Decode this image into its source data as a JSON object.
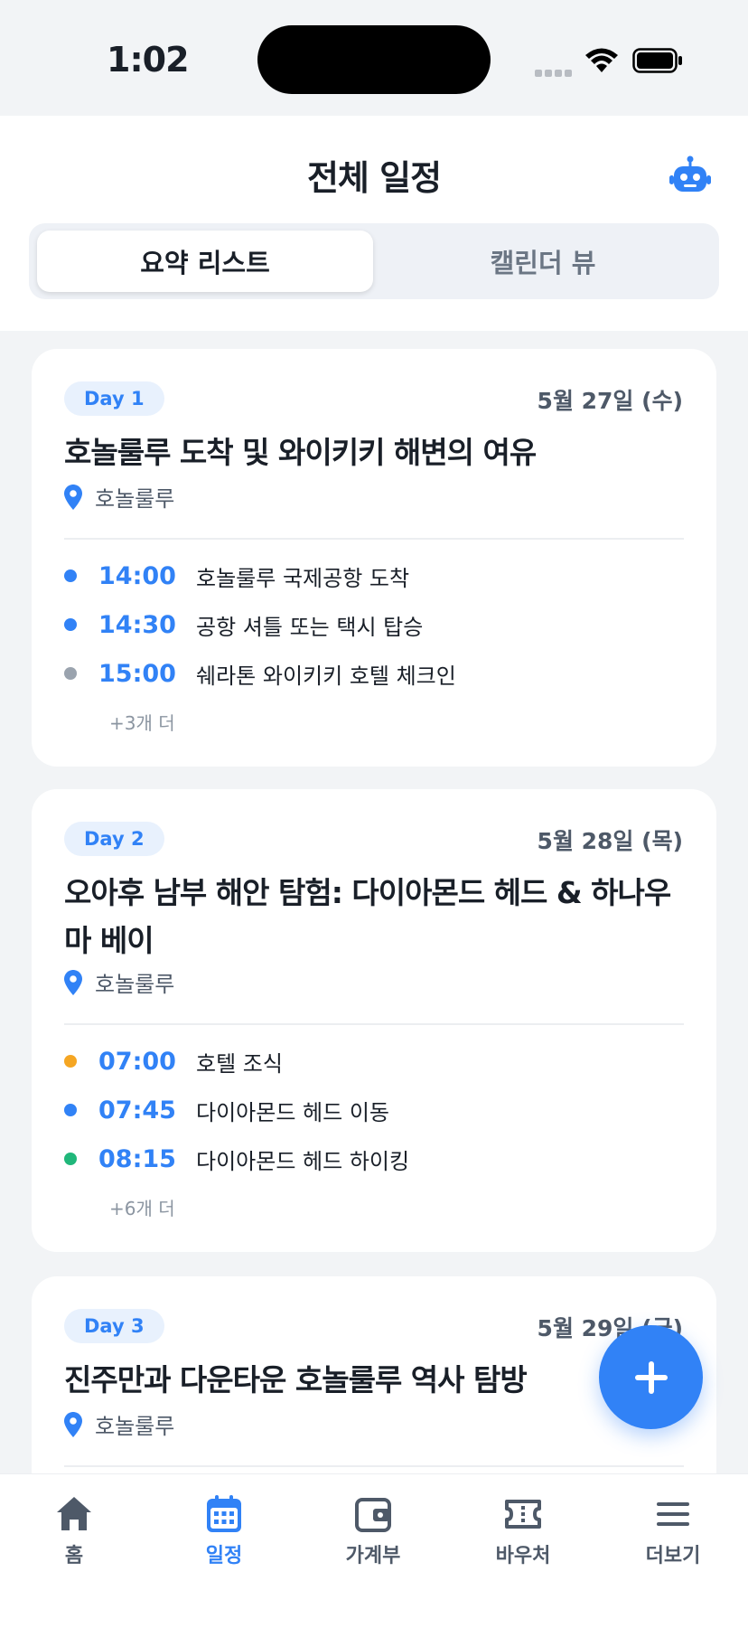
{
  "status": {
    "time": "1:02"
  },
  "header": {
    "title": "전체 일정",
    "tabs": [
      {
        "label": "요약 리스트",
        "active": true
      },
      {
        "label": "캘린더 뷰",
        "active": false
      }
    ]
  },
  "days": [
    {
      "badge": "Day 1",
      "date": "5월 27일 (수)",
      "title": "호놀룰루 도착 및 와이키키 해변의 여유",
      "location": "호놀룰루",
      "items": [
        {
          "time": "14:00",
          "text": "호놀룰루 국제공항 도착",
          "dot_color": "#3182f6"
        },
        {
          "time": "14:30",
          "text": "공항 셔틀 또는 택시 탑승",
          "dot_color": "#3182f6"
        },
        {
          "time": "15:00",
          "text": "쉐라톤 와이키키 호텔 체크인",
          "dot_color": "#9aa3ae"
        }
      ],
      "more": "+3개 더"
    },
    {
      "badge": "Day 2",
      "date": "5월 28일 (목)",
      "title": "오아후 남부 해안 탐험: 다이아몬드 헤드 & 하나우마 베이",
      "location": "호놀룰루",
      "items": [
        {
          "time": "07:00",
          "text": "호텔 조식",
          "dot_color": "#f5a623"
        },
        {
          "time": "07:45",
          "text": "다이아몬드 헤드 이동",
          "dot_color": "#3182f6"
        },
        {
          "time": "08:15",
          "text": "다이아몬드 헤드 하이킹",
          "dot_color": "#20b77a"
        }
      ],
      "more": "+6개 더"
    },
    {
      "badge": "Day 3",
      "date": "5월 29일 (금)",
      "title": "진주만과 다운타운 호놀룰루 역사 탐방",
      "location": "호놀룰루"
    }
  ],
  "tabbar": [
    {
      "label": "홈",
      "icon": "home-icon",
      "active": false
    },
    {
      "label": "일정",
      "icon": "calendar-icon",
      "active": true
    },
    {
      "label": "가계부",
      "icon": "wallet-icon",
      "active": false
    },
    {
      "label": "바우처",
      "icon": "ticket-icon",
      "active": false
    },
    {
      "label": "더보기",
      "icon": "menu-icon",
      "active": false
    }
  ],
  "colors": {
    "accent": "#3182f6",
    "text": "#191f28",
    "muted": "#8b95a1"
  }
}
